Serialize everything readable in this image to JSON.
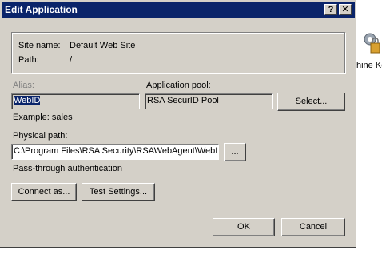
{
  "window": {
    "title": "Edit Application",
    "help_label": "?",
    "close_label": "✕"
  },
  "background": {
    "label": "hine Ke",
    "icon": "gear-lock-icon"
  },
  "site_info": {
    "site_name_label": "Site name:",
    "site_name_value": "Default Web Site",
    "path_label": "Path:",
    "path_value": "/"
  },
  "alias": {
    "label": "Alias:",
    "value": "WebID",
    "example": "Example: sales"
  },
  "app_pool": {
    "label": "Application pool:",
    "value": "RSA SecurID Pool",
    "select_button": "Select..."
  },
  "physical_path": {
    "label": "Physical path:",
    "value": "C:\\Program Files\\RSA Security\\RSAWebAgent\\WebID",
    "browse_button": "..."
  },
  "auth": {
    "text": "Pass-through authentication",
    "connect_as_button": "Connect as...",
    "test_settings_button": "Test Settings..."
  },
  "footer": {
    "ok_button": "OK",
    "cancel_button": "Cancel"
  },
  "colors": {
    "titlebar": "#0a246a",
    "face": "#d4d0c8",
    "selection": "#0a246a"
  }
}
